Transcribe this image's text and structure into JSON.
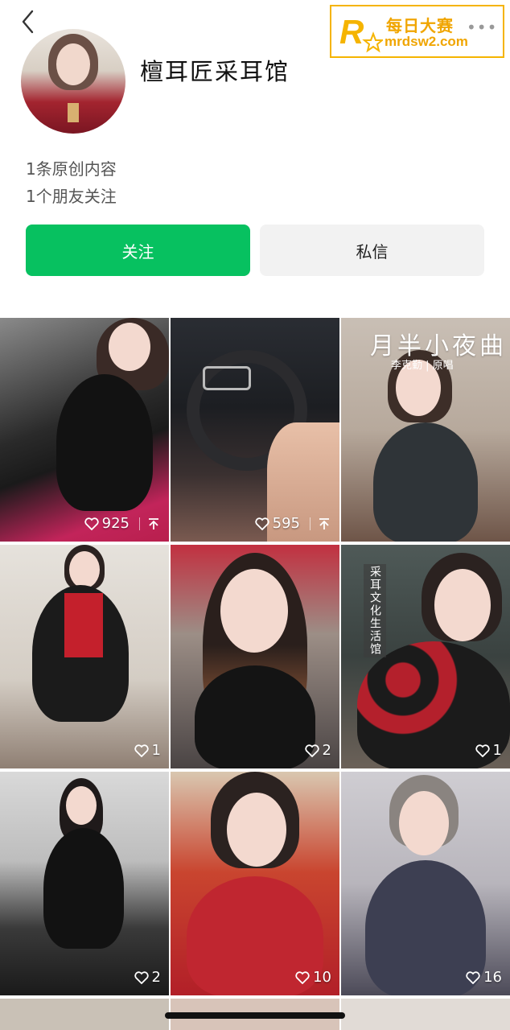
{
  "nav": {
    "back_icon": "chevron-left-icon",
    "more_icon": "more-dots-icon",
    "more_label": "•••"
  },
  "watermark": {
    "logo_icon": "r-star-logo",
    "brand_cn": "每日大赛",
    "url": "mrdsw2.com"
  },
  "profile": {
    "name": "檀耳匠采耳馆",
    "original_count_text": "1条原创内容",
    "friends_follow_text": "1个朋友关注"
  },
  "actions": {
    "follow_label": "关注",
    "message_label": "私信"
  },
  "colors": {
    "accent_green": "#07c160",
    "watermark_gold": "#f0a500"
  },
  "posts": [
    {
      "likes": "925",
      "pinned": true,
      "overlay": ""
    },
    {
      "likes": "595",
      "pinned": true,
      "overlay": ""
    },
    {
      "likes": "",
      "pinned": false,
      "overlay": "月半小夜曲",
      "overlay_sub": "李克勤 | 原唱"
    },
    {
      "likes": "1",
      "pinned": false,
      "overlay": ""
    },
    {
      "likes": "2",
      "pinned": false,
      "overlay": ""
    },
    {
      "likes": "1",
      "pinned": false,
      "overlay": "采耳文化生活馆"
    },
    {
      "likes": "2",
      "pinned": false,
      "overlay": ""
    },
    {
      "likes": "10",
      "pinned": false,
      "overlay": ""
    },
    {
      "likes": "16",
      "pinned": false,
      "overlay": ""
    }
  ]
}
